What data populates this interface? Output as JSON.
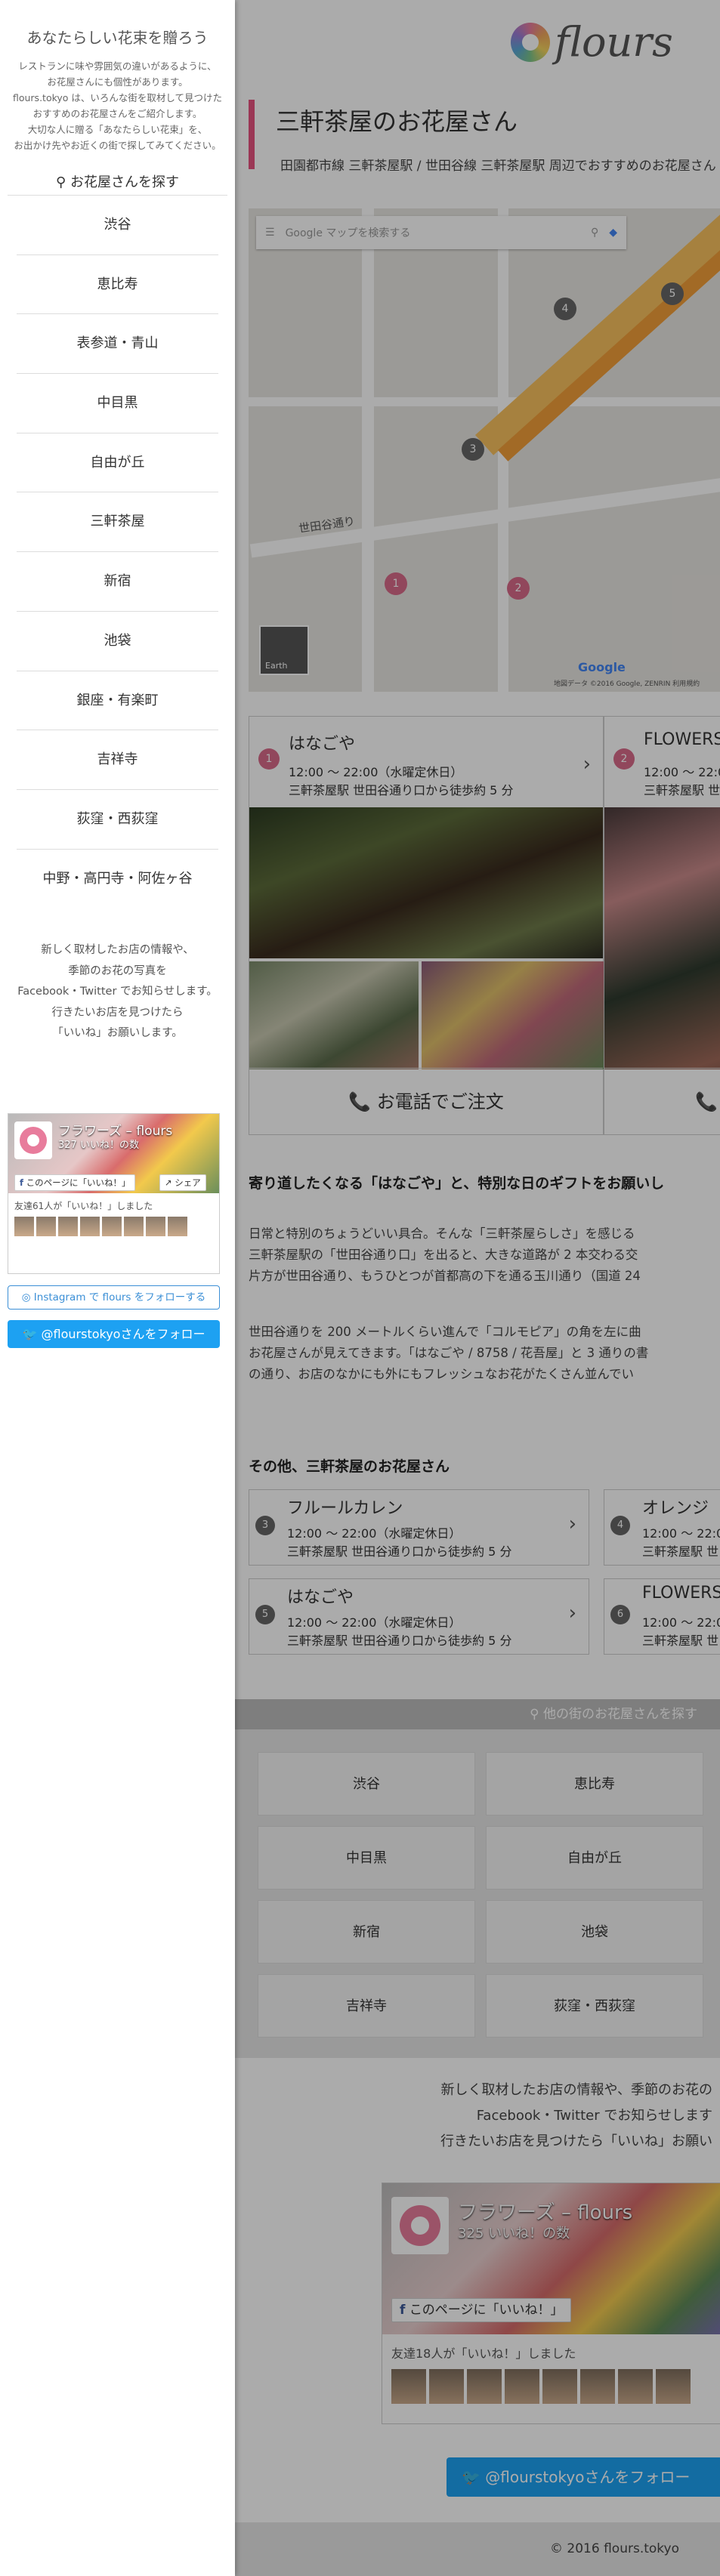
{
  "sidebar": {
    "title": "あなたらしい花束を贈ろう",
    "desc": [
      "レストランに味や雰囲気の違いがあるように、",
      "お花屋さんにも個性があります。",
      "flours.tokyo は、いろんな街を取材して見つけた",
      "おすすめのお花屋さんをご紹介します。",
      "大切な人に贈る「あなたらしい花束」を、",
      "お出かけ先やお近くの街で探してみてください。"
    ],
    "search_label": "お花屋さんを探す",
    "nav": [
      "渋谷",
      "恵比寿",
      "表参道・青山",
      "中目黒",
      "自由が丘",
      "三軒茶屋",
      "新宿",
      "池袋",
      "銀座・有楽町",
      "吉祥寺",
      "荻窪・西荻窪",
      "中野・高円寺・阿佐ヶ谷"
    ],
    "note": [
      "新しく取材したお店の情報や、",
      "季節のお花の写真を",
      "Facebook・Twitter でお知らせします。",
      "行きたいお店を見つけたら",
      "「いいね」お願いします。"
    ],
    "fb": {
      "page_name": "フラワーズ – flours",
      "likes": "327 いいね！の数",
      "like_btn": "このページに「いいね！」",
      "share_btn": "シェア",
      "friends": "友達61人が「いいね！」しました"
    },
    "instagram_btn": "Instagram で flours をフォローする",
    "twitter_btn": "@flourstokyoさんをフォロー"
  },
  "brand": "flours",
  "page_title": "三軒茶屋のお花屋さん",
  "sub_title": "田園都市線 三軒茶屋駅 / 世田谷線 三軒茶屋駅 周辺でおすすめのお花屋さん",
  "map": {
    "search_placeholder": "Google マップを検索する",
    "street_label": "世田谷通り",
    "earth_label": "Earth",
    "footer": "地図データ ©2016 Google, ZENRIN  利用規約",
    "google_label": "Google"
  },
  "cards": [
    {
      "num": "1",
      "name": "はなごや",
      "hours": "12:00 〜 22:00（水曜定休日）",
      "access": "三軒茶屋駅 世田谷通り口から徒歩約 5 分",
      "call": "お電話でご注文"
    },
    {
      "num": "2",
      "name": "FLOWERS",
      "hours": "12:00 〜 22:0",
      "access": "三軒茶屋駅 世",
      "call": ""
    }
  ],
  "intro": {
    "heading": "寄り道したくなる「はなごや」と、特別な日のギフトをお願いし",
    "p1": [
      "日常と特別のちょうどいい具合。そんな「三軒茶屋らしさ」を感じる",
      "三軒茶屋駅の「世田谷通り口」を出ると、大きな道路が 2 本交わる交",
      "片方が世田谷通り、もうひとつが首都高の下を通る玉川通り（国道 24"
    ],
    "p2": [
      "世田谷通りを 200 メートルくらい進んで「コルモピア」の角を左に曲",
      "お花屋さんが見えてきます。「はなごや / 8758 / 花吾屋」と 3 通りの書",
      "の通り、お店のなかにも外にもフレッシュなお花がたくさん並んでい"
    ]
  },
  "others": {
    "heading": "その他、三軒茶屋のお花屋さん",
    "items": [
      {
        "num": "3",
        "name": "フルールカレン",
        "hours": "12:00 〜 22:00（水曜定休日）",
        "access": "三軒茶屋駅 世田谷通り口から徒歩約 5 分"
      },
      {
        "num": "4",
        "name": "オレンジ",
        "hours": "12:00 〜 22:0",
        "access": "三軒茶屋駅 世"
      },
      {
        "num": "5",
        "name": "はなごや",
        "hours": "12:00 〜 22:00（水曜定休日）",
        "access": "三軒茶屋駅 世田谷通り口から徒歩約 5 分"
      },
      {
        "num": "6",
        "name": "FLOWERS",
        "hours": "12:00 〜 22:0",
        "access": "三軒茶屋駅 世"
      }
    ]
  },
  "other_towns": {
    "bar_label": "他の街のお花屋さんを探す",
    "items": [
      "渋谷",
      "恵比寿",
      "中目黒",
      "自由が丘",
      "新宿",
      "池袋",
      "吉祥寺",
      "荻窪・西荻窪"
    ]
  },
  "bottom_note": [
    "新しく取材したお店の情報や、季節のお花の",
    "Facebook・Twitter でお知らせします",
    "行きたいお店を見つけたら「いいね」お願い"
  ],
  "fb_big": {
    "page_name": "フラワーズ – flours",
    "likes": "325 いいね！の数",
    "like_btn": "このページに「いいね！」",
    "friends": "友達18人が「いいね！」しました"
  },
  "twitter_big": "@flourstokyoさんをフォロー",
  "footer": "© 2016 flours.tokyo",
  "colors": {
    "accent": "#e8527f",
    "twitter": "#1da1f2",
    "facebook": "#3b5998"
  }
}
